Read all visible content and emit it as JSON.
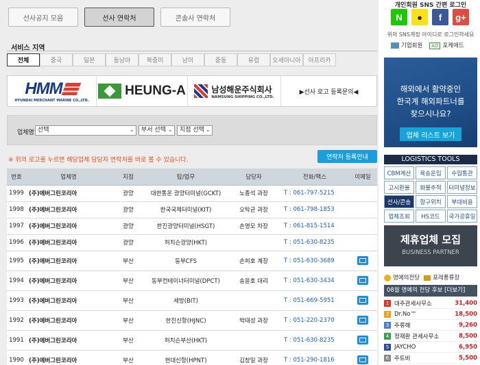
{
  "top_tabs": [
    {
      "label": "선사공지 모음",
      "active": false
    },
    {
      "label": "선사 연락처",
      "active": true
    },
    {
      "label": "콘솔사 연락처",
      "active": false
    }
  ],
  "region": {
    "title": "서비스 지역",
    "tabs": [
      "전체",
      "중국",
      "일본",
      "동남아",
      "북중미",
      "남미",
      "중동",
      "유럽",
      "오세아니아",
      "아프리카"
    ],
    "active_index": 0
  },
  "logos": {
    "hmm_name": "HMM",
    "hmm_sub": "HYUNDAI MERCHANT MARINE CO.,LTD.",
    "heunga_name": "HEUNG-A",
    "namsung_name": "남성해운주식회사",
    "namsung_sub": "NAMSUNG SHIPPING CO.,LTD.",
    "inquiry": "▶선사 로고 등록문의◀"
  },
  "filter": {
    "label": "업체명",
    "company_select": "선택",
    "branch_select": "부서 선택",
    "office_select": "지점 선택"
  },
  "notice": "※ 위의 로고를 누르면 해당업체 담당자 연락처를 바로 볼 수 있습니다.",
  "register_button": "연락처 등록안내",
  "table": {
    "headers": [
      "번호",
      "업체명",
      "지점",
      "탑/업무",
      "담당자",
      "전화/팩스",
      "이메일"
    ],
    "rows": [
      {
        "no": "1999",
        "company": "(주)에버그린코리아",
        "branch": "광양",
        "dept": "대한통운 광양터미널(GCKT)",
        "person": "노종석 과장",
        "phone": "T : 061-797-5215",
        "email": false
      },
      {
        "no": "1998",
        "company": "(주)에버그린코리아",
        "branch": "광양",
        "dept": "한국국제터미널(KIT)",
        "person": "오탁균 과장",
        "phone": "T : 061-798-1853",
        "email": false
      },
      {
        "no": "1997",
        "company": "(주)에버그린코리아",
        "branch": "광양",
        "dept": "한진광양터미널(HSGT)",
        "person": "손영모 차장",
        "phone": "T : 061-815-1514",
        "email": false
      },
      {
        "no": "1996",
        "company": "(주)에버그린코리아",
        "branch": "광양",
        "dept": "허치슨광양(HKT)",
        "person": "",
        "phone": "T : 051-630-8235",
        "email": false
      },
      {
        "no": "1995",
        "company": "(주)에버그린코리아",
        "branch": "부산",
        "dept": "동부CFS",
        "person": "손희호 계장",
        "phone": "T : 051-630-3689",
        "email": true
      },
      {
        "no": "1994",
        "company": "(주)에버그린코리아",
        "branch": "부산",
        "dept": "동부컨테이너터미널(DPCT)",
        "person": "송윤호 대리",
        "phone": "T : 051-630-3434",
        "email": true
      },
      {
        "no": "1993",
        "company": "(주)에버그린코리아",
        "branch": "부산",
        "dept": "세방(BIT)",
        "person": "",
        "phone": "T : 051-669-5951",
        "email": true
      },
      {
        "no": "1992",
        "company": "(주)에버그린코리아",
        "branch": "부산",
        "dept": "한진신항(HJNC)",
        "person": "박태성 과장",
        "phone": "T : 051-220-2370",
        "email": true
      },
      {
        "no": "1991",
        "company": "(주)에버그린코리아",
        "branch": "부산",
        "dept": "허치슨부산(HKT)",
        "person": "",
        "phone": "T : 051-630-8235",
        "email": true
      },
      {
        "no": "1990",
        "company": "(주)에버그린코리아",
        "branch": "부산",
        "dept": "현대신항(HPNT)",
        "person": "김창일 과장",
        "phone": "T : 051-290-1816",
        "email": true
      }
    ]
  },
  "sidebar": {
    "login_title": "개인회원 SNS 간편 로그인",
    "sns": [
      {
        "name": "naver",
        "glyph": "N",
        "color": "#1ec800"
      },
      {
        "name": "kakao",
        "glyph": "●",
        "color": "#f7e317"
      },
      {
        "name": "facebook",
        "glyph": "f",
        "color": "#3b5998"
      },
      {
        "name": "google",
        "glyph": "g+",
        "color": "#dc4e41"
      }
    ],
    "sns_note": "위의 SNS계정 아이디로 로그인하세요",
    "company_member": "기업회원",
    "port_ad_badge": "AD",
    "port_ad": "포케애드",
    "banner_line1": "해외에서 활약중인",
    "banner_line2": "한국계 해외파트너를",
    "banner_line3": "찾으시나요?",
    "banner_button": "업체 리스트 보기",
    "logistics_title": "LOGISTICS TOOLS",
    "tools": [
      "CBM계산",
      "육송운임",
      "수입통관",
      "고시환율",
      "화물추적",
      "터미널정보",
      "선사/콘솔",
      "항구위치",
      "부대비용",
      "업체조회",
      "HS코드",
      "국가공휴일"
    ],
    "partner_title": "제휴업체 모집",
    "partner_sub": "BUSINESS PARTNER",
    "fame_label": "명예의전당",
    "point_label": "포레풍류장",
    "fame_bar": "08월 명예의 전당 후보 [더보기]",
    "ranks": [
      {
        "n": "1",
        "name": "대주관세사무소",
        "score": "31,400",
        "color": "#d63a2f"
      },
      {
        "n": "2",
        "name": "Dr.No™",
        "score": "18,500",
        "color": "#e8a21b"
      },
      {
        "n": "3",
        "name": "주류해",
        "score": "9,260",
        "color": "#4a7fd0"
      },
      {
        "n": "4",
        "name": "정재환 관세사무소",
        "score": "8,500",
        "color": "#3aa04b"
      },
      {
        "n": "5",
        "name": "JAYCHO",
        "score": "6,950",
        "color": "#2a4a9a"
      },
      {
        "n": "6",
        "name": "주트비",
        "score": "5,500",
        "color": "#888888"
      }
    ]
  }
}
